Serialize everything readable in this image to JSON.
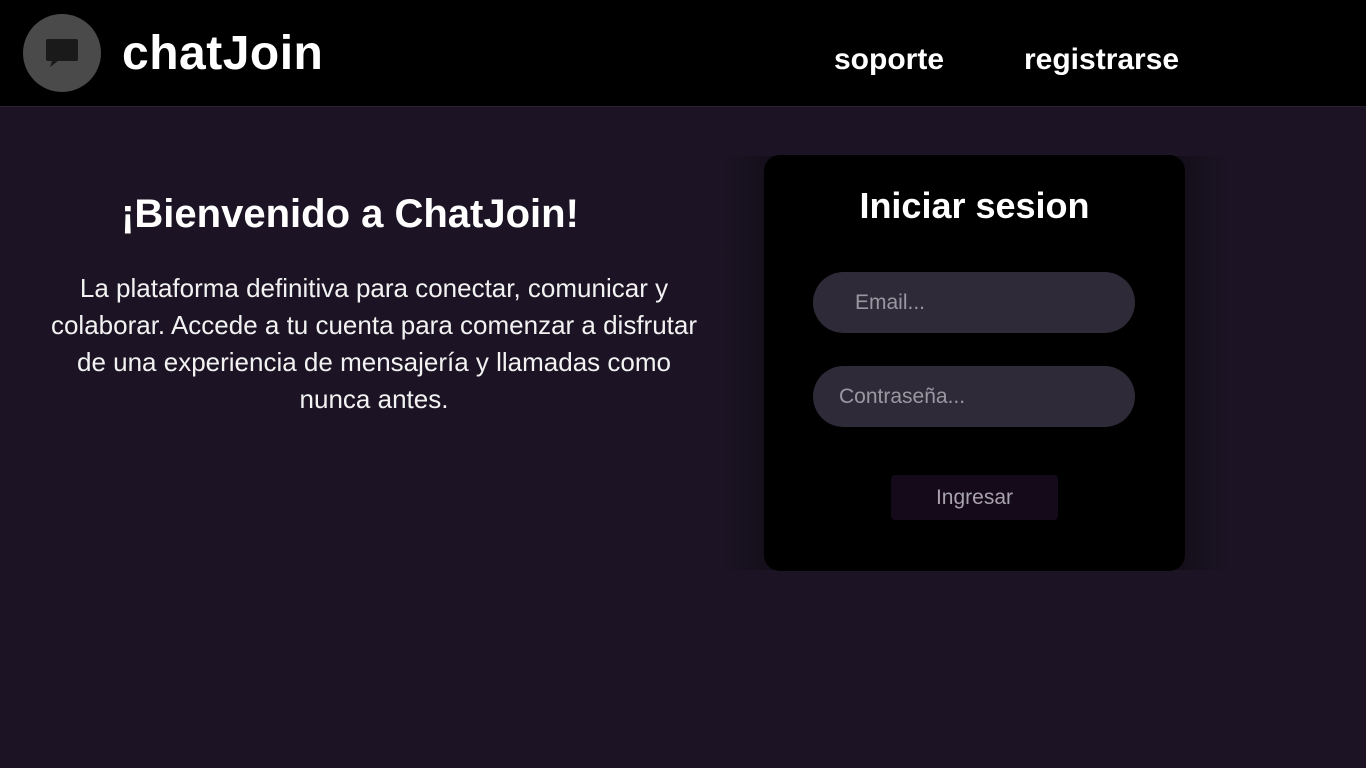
{
  "header": {
    "brand": "chatJoin",
    "logo_icon": "chat-bubble-icon",
    "nav": {
      "support": "soporte",
      "register": "registrarse"
    }
  },
  "welcome": {
    "title": "¡Bienvenido a ChatJoin!",
    "text": "La plataforma definitiva para conectar, comunicar y colaborar. Accede a tu cuenta para comenzar a disfrutar de una experiencia de mensajería y llamadas como nunca antes."
  },
  "login": {
    "title": "Iniciar sesion",
    "email_value": "",
    "email_placeholder": "Email...",
    "password_value": "",
    "password_placeholder": "Contraseña...",
    "submit_label": "Ingresar"
  },
  "colors": {
    "page_background": "#1c1424",
    "header_background": "#000000",
    "panel_background": "#000000",
    "input_background": "#2f2a38",
    "button_background": "#140a1a"
  }
}
